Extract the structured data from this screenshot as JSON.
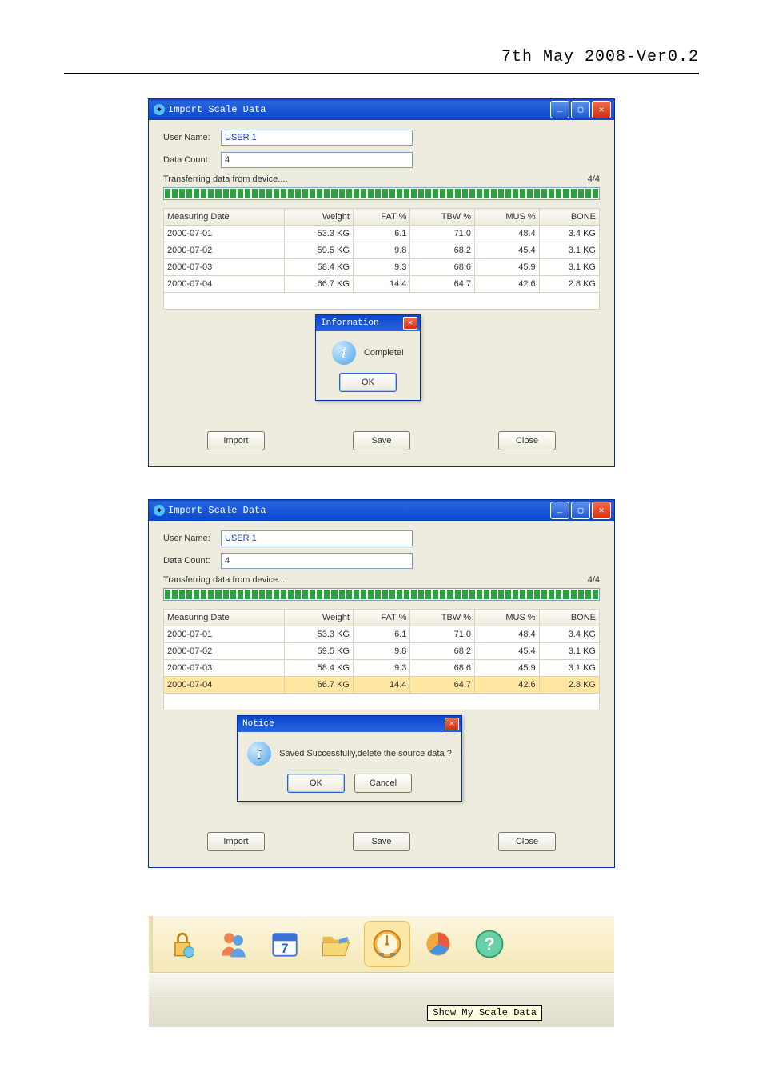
{
  "header": {
    "version_line": "7th May 2008-Ver0.2"
  },
  "window": {
    "title": "Import Scale Data",
    "user_label": "User Name:",
    "user_value": "USER 1",
    "count_label": "Data Count:",
    "count_value": "4",
    "transfer_label": "Transferring data from device....",
    "progress_text": "4/4",
    "columns": [
      "Measuring Date",
      "Weight",
      "FAT %",
      "TBW %",
      "MUS %",
      "BONE"
    ],
    "rows": [
      {
        "date": "2000-07-01",
        "weight": "53.3 KG",
        "fat": "6.1",
        "tbw": "71.0",
        "mus": "48.4",
        "bone": "3.4 KG"
      },
      {
        "date": "2000-07-02",
        "weight": "59.5 KG",
        "fat": "9.8",
        "tbw": "68.2",
        "mus": "45.4",
        "bone": "3.1 KG"
      },
      {
        "date": "2000-07-03",
        "weight": "58.4 KG",
        "fat": "9.3",
        "tbw": "68.6",
        "mus": "45.9",
        "bone": "3.1 KG"
      },
      {
        "date": "2000-07-04",
        "weight": "66.7 KG",
        "fat": "14.4",
        "tbw": "64.7",
        "mus": "42.6",
        "bone": "2.8 KG"
      }
    ],
    "buttons": {
      "import": "Import",
      "save": "Save",
      "close": "Close"
    }
  },
  "modal1": {
    "title": "Information",
    "msg": "Complete!",
    "ok": "OK"
  },
  "modal2": {
    "title": "Notice",
    "msg": "Saved Successfully,delete the source data ?",
    "ok": "OK",
    "cancel": "Cancel"
  },
  "toolbar": {
    "icons": [
      {
        "name": "lock-icon"
      },
      {
        "name": "users-icon"
      },
      {
        "name": "calendar-icon"
      },
      {
        "name": "folder-open-icon"
      },
      {
        "name": "scale-data-icon"
      },
      {
        "name": "chart-icon"
      },
      {
        "name": "help-icon"
      }
    ],
    "tooltip": "Show My Scale Data"
  }
}
